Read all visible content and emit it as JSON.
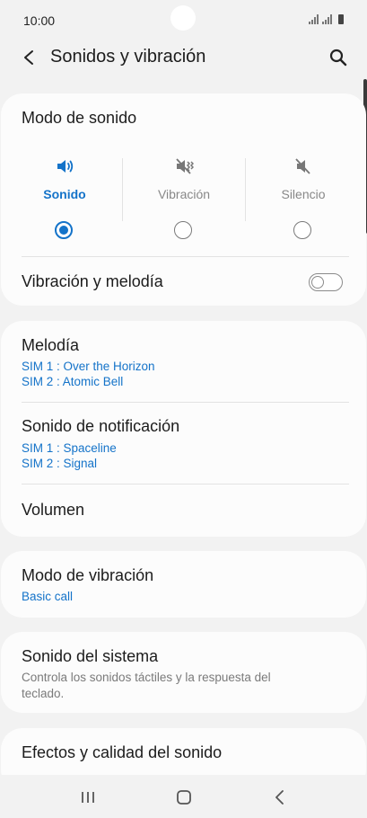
{
  "status_bar": {
    "time": "10:00"
  },
  "app_bar": {
    "title": "Sonidos y vibración"
  },
  "sound_mode": {
    "title": "Modo de sonido",
    "options": [
      {
        "label": "Sonido",
        "icon": "speaker-icon",
        "selected": true
      },
      {
        "label": "Vibración",
        "icon": "vibrate-icon",
        "selected": false
      },
      {
        "label": "Silencio",
        "icon": "mute-icon",
        "selected": false
      }
    ],
    "vibrate_with_ringtone": {
      "label": "Vibración y melodía",
      "enabled": false
    }
  },
  "ringtones": {
    "ringtone": {
      "title": "Melodía",
      "sim1": "SIM 1 : Over the Horizon",
      "sim2": "SIM 2 : Atomic Bell"
    },
    "notification": {
      "title": "Sonido de notificación",
      "sim1": "SIM 1 : Spaceline",
      "sim2": "SIM 2 : Signal"
    },
    "volume": {
      "title": "Volumen"
    }
  },
  "vibration_pattern": {
    "title": "Modo de vibración",
    "value": "Basic call"
  },
  "system_sound": {
    "title": "Sonido del sistema",
    "description_line1": "Controla los sonidos táctiles y la respuesta del",
    "description_line2": "teclado."
  },
  "sound_quality": {
    "title": "Efectos y calidad del sonido"
  },
  "colors": {
    "accent": "#1473c9",
    "background": "#f2f2f2",
    "card": "#fcfcfc"
  }
}
